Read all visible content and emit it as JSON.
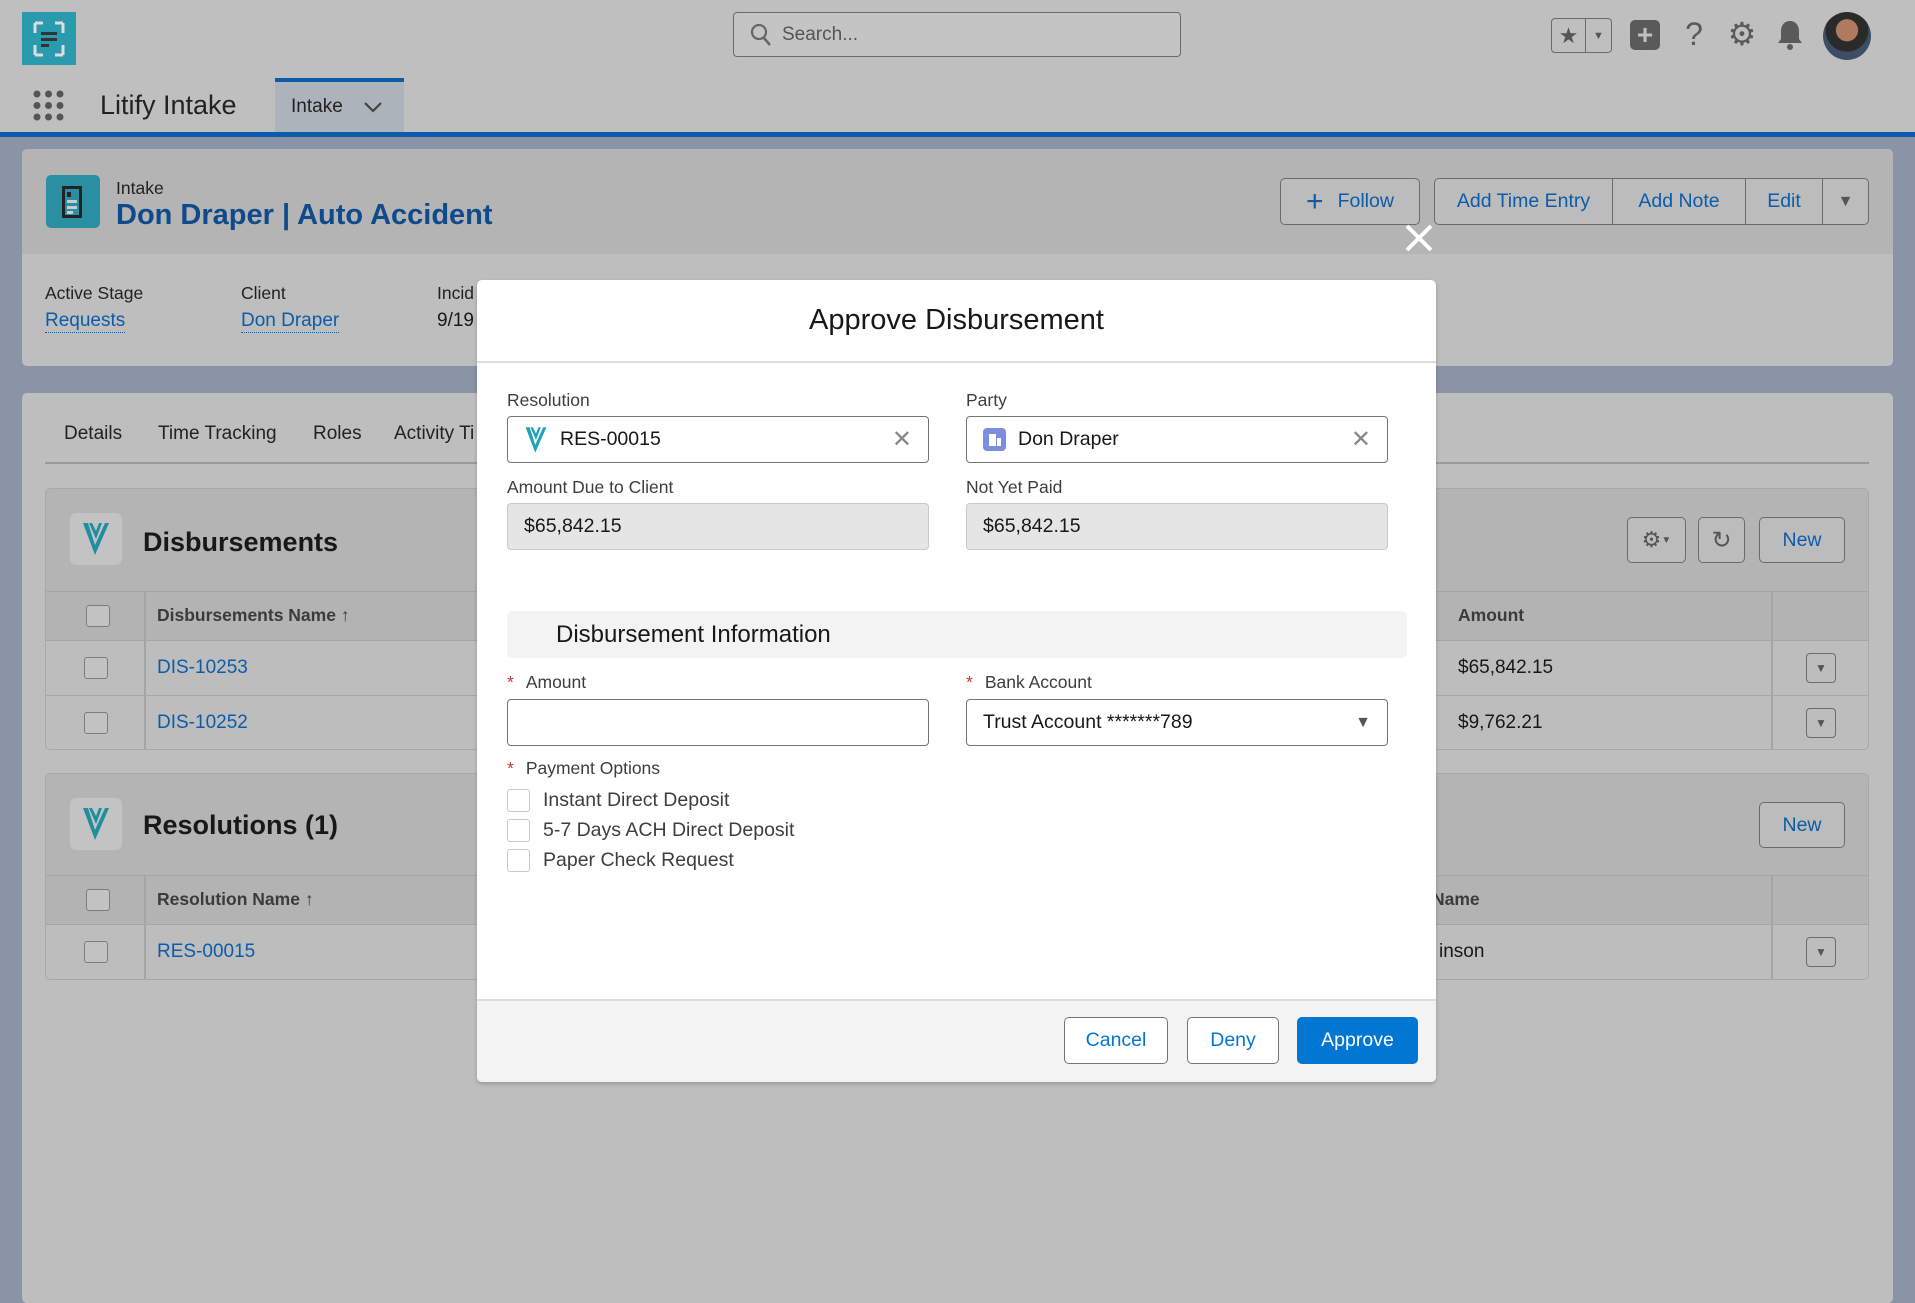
{
  "header": {
    "search_placeholder": "Search...",
    "app_name": "Litify Intake",
    "nav_tab": "Intake"
  },
  "record": {
    "object": "Intake",
    "title": "Don Draper | Auto Accident",
    "follow": "Follow",
    "actions": [
      "Add Time Entry",
      "Add Note",
      "Edit"
    ],
    "fields": [
      {
        "label": "Active Stage",
        "value": "Requests"
      },
      {
        "label": "Client",
        "value": "Don Draper"
      },
      {
        "label": "Incid",
        "value": "9/19"
      }
    ]
  },
  "tabs": [
    "Details",
    "Time Tracking",
    "Roles",
    "Activity Ti"
  ],
  "disbursements": {
    "title": "Disbursements",
    "new": "New",
    "columns": {
      "name": "Disbursements Name",
      "amount": "Amount"
    },
    "rows": [
      {
        "name": "DIS-10253",
        "amount": "$65,842.15"
      },
      {
        "name": "DIS-10252",
        "amount": "$9,762.21"
      }
    ]
  },
  "resolutions": {
    "title": "Resolutions (1)",
    "new": "New",
    "columns": {
      "name": "Resolution Name",
      "other": "Name"
    },
    "rows": [
      {
        "name": "RES-00015",
        "other": "inson"
      }
    ]
  },
  "modal": {
    "title": "Approve Disbursement",
    "resolution_label": "Resolution",
    "resolution_value": "RES-00015",
    "party_label": "Party",
    "party_value": "Don Draper",
    "amount_due_label": "Amount Due to Client",
    "amount_due_value": "$65,842.15",
    "not_yet_paid_label": "Not Yet Paid",
    "not_yet_paid_value": "$65,842.15",
    "section": "Disbursement Information",
    "amount_label": "Amount",
    "amount_value": "",
    "bank_label": "Bank Account",
    "bank_value": "Trust Account *******789",
    "payment_label": "Payment Options",
    "required_mark": "*",
    "payment_options": [
      {
        "label": "Instant Direct Deposit",
        "checked": false
      },
      {
        "label": "5-7 Days ACH Direct Deposit",
        "checked": false
      },
      {
        "label": "Paper Check Request",
        "checked": false
      }
    ],
    "cancel": "Cancel",
    "deny": "Deny",
    "approve": "Approve"
  },
  "colors": {
    "brand_blue": "#0b5cab",
    "approve": "#0176d3",
    "litify_teal": "#2a9aae"
  }
}
